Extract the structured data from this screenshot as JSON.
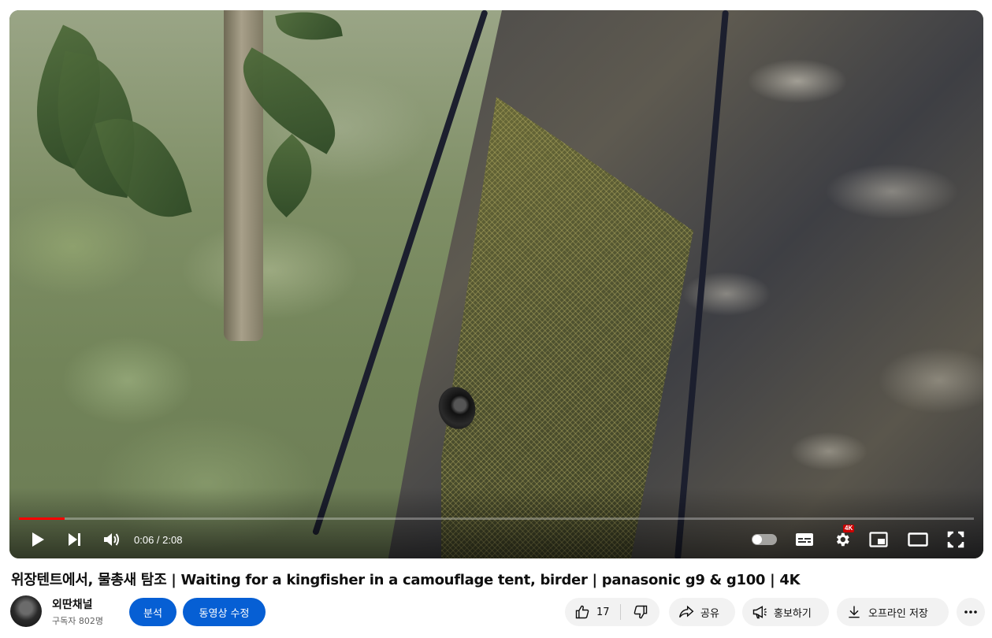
{
  "video": {
    "progress_fraction": 0.048,
    "current_time": "0:06",
    "time_separator": " / ",
    "duration": "2:08",
    "quality_badge": "4K",
    "accent_color": "#ff0000"
  },
  "title": "위장텐트에서, 물총새 탐조 | Waiting for a kingfisher in a camouflage tent, birder | panasonic g9 & g100 | 4K",
  "channel": {
    "name": "외딴채널",
    "subscribers": "구독자 802명"
  },
  "actions": {
    "analytics_label": "분석",
    "edit_video_label": "동영상 수정",
    "like_count": "17",
    "share_label": "공유",
    "promote_label": "홍보하기",
    "download_label": "오프라인 저장"
  },
  "icons": {
    "play": "play-icon",
    "next": "next-icon",
    "volume": "volume-icon",
    "autoplay": "autoplay-toggle-icon",
    "subtitles": "subtitles-icon",
    "settings": "gear-icon",
    "miniplayer": "miniplayer-icon",
    "theater": "theater-icon",
    "fullscreen": "fullscreen-icon",
    "like": "thumbs-up-icon",
    "dislike": "thumbs-down-icon",
    "share": "share-icon",
    "promote": "megaphone-icon",
    "download": "download-icon",
    "more": "more-icon"
  },
  "colors": {
    "primary_button": "#065fd4",
    "secondary_button": "#f2f2f2"
  }
}
